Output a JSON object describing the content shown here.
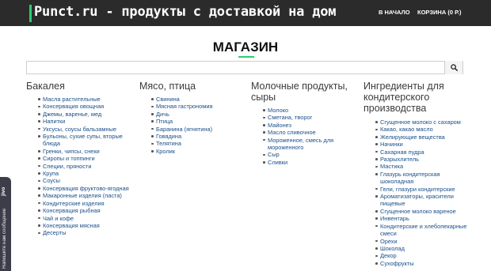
{
  "header": {
    "site_title": "Punct.ru - продукты с доставкой на дом",
    "nav": {
      "home": "В НАЧАЛО",
      "cart": "КОРЗИНА (0 Р.)"
    }
  },
  "page_title": "МАГАЗИН",
  "search": {
    "placeholder": "",
    "button_icon": "search-icon"
  },
  "categories": [
    {
      "heading": "Бакалея",
      "items": [
        "Масла растительные",
        "Консервация овощная",
        "Джемы, варенье, мед",
        "Напитки",
        "Уксусы, соусы бальзамные",
        "Бульоны, сухие супы, вторые блюда",
        "Гренки, чипсы, снеки",
        "Сиропы и топпинги",
        "Специи, пряности",
        "Крупа",
        "Соусы",
        "Консервация фруктово-ягодная",
        "Макаронные изделия (паста)",
        "Кондитерские изделия",
        "Консервация рыбная",
        "Чай и кофе",
        "Консервация мясная",
        "Десерты"
      ]
    },
    {
      "heading": "Мясо, птица",
      "items": [
        "Свинина",
        "Мясная гастрономия",
        "Дичь",
        "Птица",
        "Баранина (ягнятина)",
        "Говядина",
        "Телятина",
        "Кролик"
      ]
    },
    {
      "heading": "Молочные продукты, сыры",
      "items": [
        "Молоко",
        "Сметана, творог",
        "Майонез",
        "Масло сливочное",
        "Мороженное, смесь для мороженного",
        "Сыр",
        "Сливки"
      ]
    },
    {
      "heading": "Ингредиенты для кондитерского производства",
      "items": [
        "Сгущенное молоко с сахаром",
        "Какао, какао масло",
        "Желирующие вещества",
        "Начинки",
        "Сахарная пудра",
        "Разрыхлитель",
        "Мастика",
        "Глазурь кондитерская шоколадная",
        "Гели, глазури кондитерские",
        "Ароматизаторы, красители пищевые",
        "Сгущенное молоко вареное",
        "Инвентарь",
        "Кондитерские и хлебопекарные смеси",
        "Орехи",
        "Шоколад",
        "Декор",
        "Сухофрукты"
      ]
    }
  ],
  "side_widget": {
    "brand": "jivo",
    "label": "Напишите нам сообщение"
  },
  "colors": {
    "accent": "#2ecc71",
    "topbar": "#2b2b2b",
    "link": "#1a4f8a"
  }
}
